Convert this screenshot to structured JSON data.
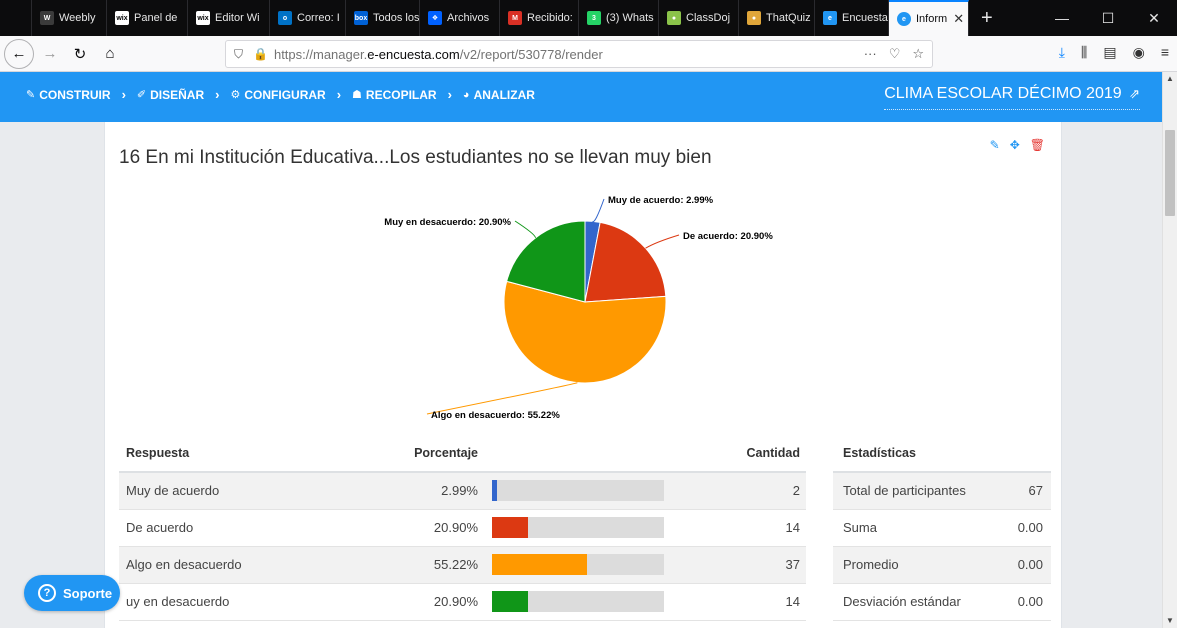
{
  "browser": {
    "tabs": [
      {
        "label": "Weebly",
        "icon": "weebly-icon",
        "color": "#3b3b3b",
        "glyph": "W"
      },
      {
        "label": "Panel de",
        "icon": "wix-icon",
        "color": "#ffffff",
        "glyph": "wix"
      },
      {
        "label": "Editor Wi",
        "icon": "wix-icon",
        "color": "#ffffff",
        "glyph": "wix"
      },
      {
        "label": "Correo: I",
        "icon": "outlook-icon",
        "color": "#0072c6",
        "glyph": "o"
      },
      {
        "label": "Todos los",
        "icon": "box-icon",
        "color": "#0061d5",
        "glyph": "box"
      },
      {
        "label": "Archivos",
        "icon": "dropbox-icon",
        "color": "#0061ff",
        "glyph": "❖"
      },
      {
        "label": "Recibido:",
        "icon": "gmail-icon",
        "color": "#d93025",
        "glyph": "M"
      },
      {
        "label": "(3) Whats",
        "icon": "whatsapp-icon",
        "color": "#25d366",
        "glyph": "3"
      },
      {
        "label": "ClassDoj",
        "icon": "classdojo-icon",
        "color": "#8bc34a",
        "glyph": "●"
      },
      {
        "label": "ThatQuiz",
        "icon": "thatquiz-icon",
        "color": "#e0a63a",
        "glyph": "●"
      },
      {
        "label": "Encuesta",
        "icon": "encuesta-icon",
        "color": "#2196f3",
        "glyph": "e"
      }
    ],
    "active_tab": {
      "label": "Inform",
      "icon": "encuesta-icon",
      "color": "#2196f3"
    },
    "url_prefix": "https://manager.",
    "url_domain": "e-encuesta.com",
    "url_path": "/v2/report/530778/render"
  },
  "app": {
    "steps": [
      {
        "label": "CONSTRUIR",
        "icon": "edit-icon",
        "glyph": "✎"
      },
      {
        "label": "DISEÑAR",
        "icon": "brush-icon",
        "glyph": "✐"
      },
      {
        "label": "CONFIGURAR",
        "icon": "cogs-icon",
        "glyph": "⚙"
      },
      {
        "label": "RECOPILAR",
        "icon": "users-icon",
        "glyph": "☗"
      },
      {
        "label": "ANALIZAR",
        "icon": "chart-pie-icon",
        "glyph": "◕"
      }
    ],
    "survey_title": "CLIMA ESCOLAR DÉCIMO 2019",
    "accent": "#2196f3"
  },
  "question": {
    "title": "16 En mi Institución Educativa...Los estudiantes no se llevan muy bien"
  },
  "chart_data": {
    "type": "pie",
    "categories": [
      "Muy de acuerdo",
      "De acuerdo",
      "Algo en desacuerdo",
      "Muy en desacuerdo"
    ],
    "values": [
      2.99,
      20.9,
      55.22,
      20.9
    ],
    "labels": [
      "Muy de acuerdo: 2.99%",
      "De acuerdo: 20.90%",
      "Algo en desacuerdo: 55.22%",
      "Muy en desacuerdo: 20.90%"
    ],
    "colors": [
      "#3366cc",
      "#dc3912",
      "#ff9900",
      "#109618"
    ]
  },
  "table": {
    "headers": {
      "respuesta": "Respuesta",
      "porcentaje": "Porcentaje",
      "cantidad": "Cantidad"
    },
    "rows": [
      {
        "respuesta": "Muy de acuerdo",
        "porcentaje": "2.99%",
        "fraction": 0.0299,
        "cantidad": "2",
        "color": "#3366cc"
      },
      {
        "respuesta": "De acuerdo",
        "porcentaje": "20.90%",
        "fraction": 0.209,
        "cantidad": "14",
        "color": "#dc3912"
      },
      {
        "respuesta": "Algo en desacuerdo",
        "porcentaje": "55.22%",
        "fraction": 0.5522,
        "cantidad": "37",
        "color": "#ff9900"
      },
      {
        "respuesta": "uy en desacuerdo",
        "porcentaje": "20.90%",
        "fraction": 0.209,
        "cantidad": "14",
        "color": "#109618"
      }
    ]
  },
  "stats": {
    "header": "Estadísticas",
    "rows": [
      {
        "label": "Total de participantes",
        "value": "67"
      },
      {
        "label": "Suma",
        "value": "0.00"
      },
      {
        "label": "Promedio",
        "value": "0.00"
      },
      {
        "label": "Desviación estándar",
        "value": "0.00"
      }
    ]
  },
  "support": {
    "label": "Soporte",
    "icon": "question-circle-icon"
  }
}
